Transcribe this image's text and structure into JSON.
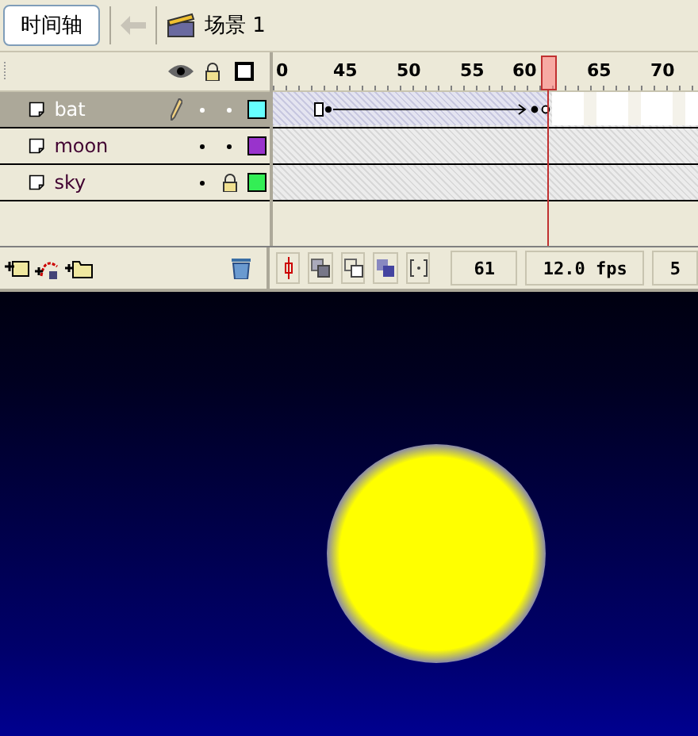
{
  "toolbar": {
    "timeline_button": "时间轴",
    "scene_label": "场景 1"
  },
  "ruler": {
    "labels": [
      "0",
      "45",
      "50",
      "55",
      "60",
      "65",
      "70"
    ]
  },
  "layers": [
    {
      "name": "bat",
      "selected": true,
      "editing": true,
      "locked": false,
      "color": "#66ffff"
    },
    {
      "name": "moon",
      "selected": false,
      "editing": false,
      "locked": false,
      "color": "#9933cc"
    },
    {
      "name": "sky",
      "selected": false,
      "editing": false,
      "locked": true,
      "color": "#33ee55"
    }
  ],
  "status": {
    "current_frame": "61",
    "frame_rate": "12.0 fps",
    "elapsed": "5"
  }
}
